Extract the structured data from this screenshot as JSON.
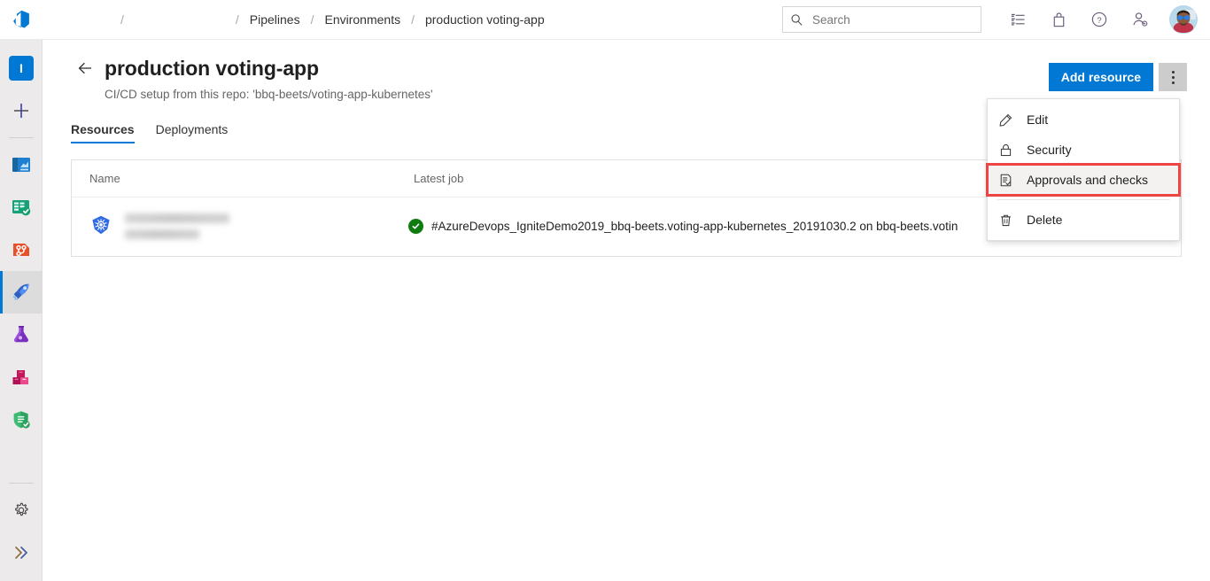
{
  "topbar": {
    "logo_icon": "azure-devops-logo",
    "breadcrumb": [
      {
        "label": "",
        "blurred": true
      },
      {
        "label": "",
        "blurred": true
      },
      {
        "label": "Pipelines",
        "blurred": false
      },
      {
        "label": "Environments",
        "blurred": false
      },
      {
        "label": "production voting-app",
        "blurred": false
      }
    ],
    "separator": "/",
    "search": {
      "placeholder": "Search",
      "value": "",
      "icon": "search-icon"
    },
    "icons": [
      {
        "name": "work-items-icon",
        "glyph": "list"
      },
      {
        "name": "marketplace-bag-icon",
        "glyph": "bag"
      },
      {
        "name": "help-icon",
        "glyph": "question-circle"
      },
      {
        "name": "user-settings-icon",
        "glyph": "person-gear"
      }
    ],
    "avatar": {
      "name": "user-avatar"
    }
  },
  "sidebar": {
    "project_initial": "I",
    "items": [
      {
        "name": "project-avatar",
        "icon": "project-square",
        "selected": false
      },
      {
        "name": "new-item",
        "icon": "plus-icon",
        "selected": false
      },
      {
        "name": "overview",
        "icon": "overview-icon",
        "selected": false
      },
      {
        "name": "boards",
        "icon": "boards-icon",
        "selected": false
      },
      {
        "name": "repos",
        "icon": "repos-icon",
        "selected": false
      },
      {
        "name": "pipelines",
        "icon": "pipelines-rocket-icon",
        "selected": true
      },
      {
        "name": "test-plans",
        "icon": "test-plans-flask-icon",
        "selected": false
      },
      {
        "name": "artifacts",
        "icon": "artifacts-boxes-icon",
        "selected": false
      },
      {
        "name": "advanced-security",
        "icon": "shield-check-icon",
        "selected": false
      }
    ],
    "bottom_items": [
      {
        "name": "project-settings",
        "icon": "gear-icon"
      },
      {
        "name": "expand-menu",
        "icon": "double-chevron-right-icon"
      }
    ]
  },
  "page": {
    "back_icon": "back-arrow-icon",
    "title": "production voting-app",
    "subtitle": "CI/CD setup from this repo: 'bbq-beets/voting-app-kubernetes'",
    "add_resource_label": "Add resource",
    "more_actions_name": "more-actions-button",
    "tabs": [
      {
        "label": "Resources",
        "active": true
      },
      {
        "label": "Deployments",
        "active": false
      }
    ]
  },
  "table": {
    "columns": [
      "Name",
      "Latest job"
    ],
    "rows": [
      {
        "icon": "kubernetes-icon",
        "name": "",
        "name_blurred": true,
        "status": "succeeded",
        "job": "#AzureDevops_IgniteDemo2019_bbq-beets.voting-app-kubernetes_20191030.2 on bbq-beets.votin"
      }
    ]
  },
  "context_menu": {
    "items": [
      {
        "label": "Edit",
        "icon": "pencil-icon",
        "highlighted": false
      },
      {
        "label": "Security",
        "icon": "lock-icon",
        "highlighted": false
      },
      {
        "label": "Approvals and checks",
        "icon": "checklist-icon",
        "highlighted": true
      },
      {
        "label": "Delete",
        "icon": "trash-icon",
        "highlighted": false
      }
    ]
  },
  "colors": {
    "accent": "#0078d4",
    "success": "#107c10",
    "highlight_border": "#ef4444",
    "rail_bg": "#eceaea"
  }
}
